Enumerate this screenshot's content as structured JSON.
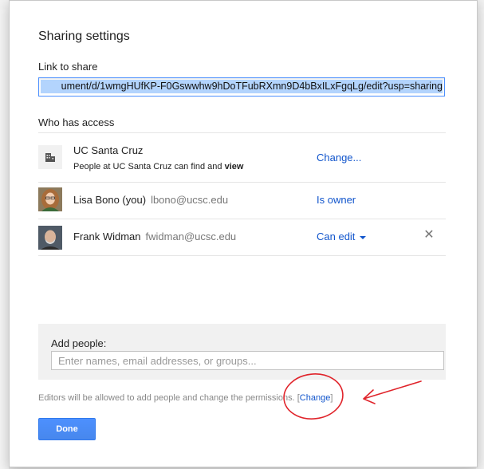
{
  "dialog": {
    "title": "Sharing settings",
    "link_label": "Link to share",
    "link_value": "ument/d/1wmgHUfKP-F0Gswwhw9hDoTFubRXmn9D4bBxILxFgqLg/edit?usp=sharing",
    "who_has_access_label": "Who has access"
  },
  "access_list": [
    {
      "name": "UC Santa Cruz",
      "description_prefix": "People at UC Santa Cruz can find and",
      "description_bold": "view",
      "access": "Change...",
      "icon": "building-icon"
    },
    {
      "name": "Lisa Bono (you)",
      "email": "lbono@ucsc.edu",
      "access": "Is owner"
    },
    {
      "name": "Frank Widman",
      "email": "fwidman@ucsc.edu",
      "access": "Can edit",
      "remove_icon": "close-icon"
    }
  ],
  "add_people": {
    "label": "Add people:",
    "placeholder": "Enter names, email addresses, or groups..."
  },
  "footer": {
    "note": "Editors will be allowed to add people and change the permissions.",
    "change_link": "Change",
    "bracket_open": "[",
    "bracket_close": "]",
    "done_label": "Done"
  },
  "colors": {
    "accent_link": "#1155cc",
    "button_blue": "#4d90fe",
    "annotation_red": "#e0242b"
  }
}
